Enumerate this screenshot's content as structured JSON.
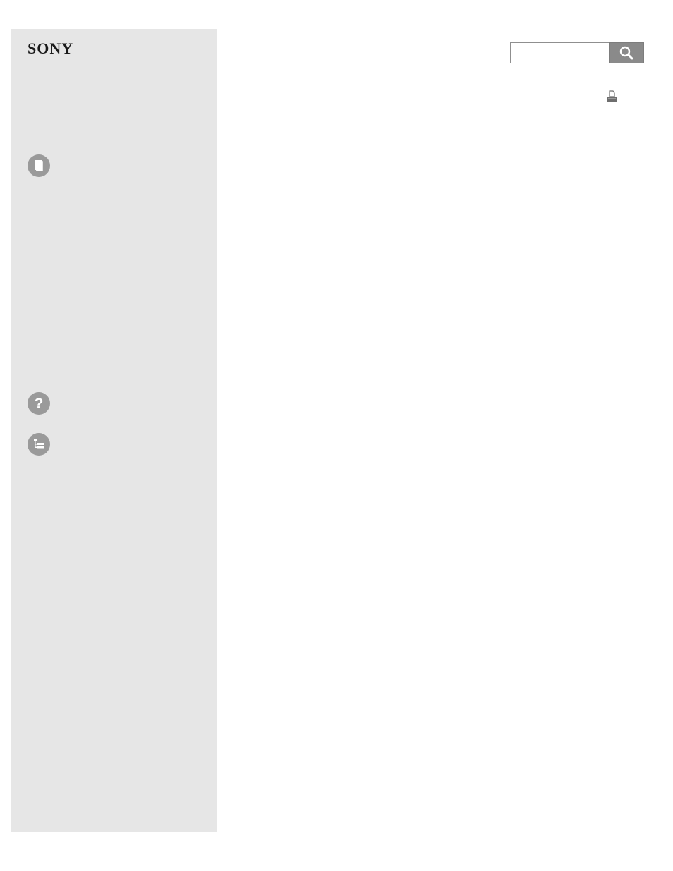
{
  "brand": {
    "logo_text": "SONY"
  },
  "sidebar": {
    "icons": [
      {
        "name": "manual-icon"
      },
      {
        "name": "help-icon",
        "glyph": "?"
      },
      {
        "name": "list-icon"
      }
    ]
  },
  "search": {
    "value": "",
    "placeholder": "",
    "button_icon": "search-icon"
  },
  "toolbar": {
    "print_icon": "print-icon"
  },
  "colors": {
    "sidebar_bg": "#e6e6e6",
    "icon_bg": "#9a9a9a",
    "search_button_bg": "#8a8a8a",
    "rule": "#d5d5d5"
  }
}
